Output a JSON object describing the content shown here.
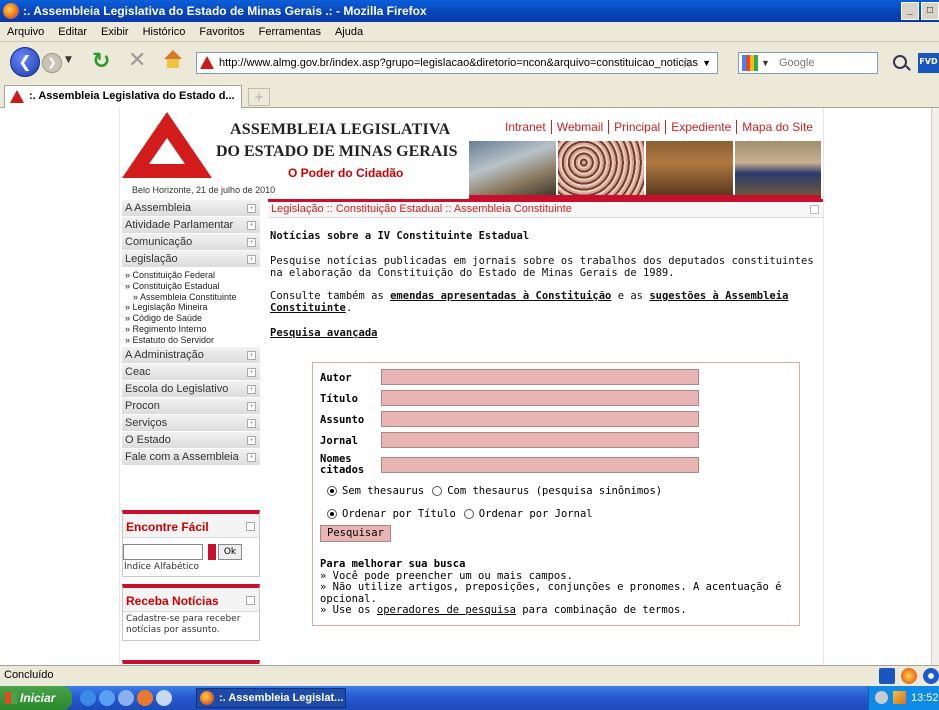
{
  "window": {
    "title": ":. Assembleia Legislativa do Estado de Minas Gerais .: - Mozilla Firefox",
    "controls": [
      "_",
      "□"
    ]
  },
  "menu": [
    "Arquivo",
    "Editar",
    "Exibir",
    "Histórico",
    "Favoritos",
    "Ferramentas",
    "Ajuda"
  ],
  "nav": {
    "url": "http://www.almg.gov.br/index.asp?grupo=legislacao&diretorio=ncon&arquivo=constituicao_noticias",
    "search_placeholder": "Google"
  },
  "tab": {
    "title": ":. Assembleia Legislativa do Estado d..."
  },
  "site": {
    "brand_line1": "ASSEMBLEIA LEGISLATIVA",
    "brand_line2": "DO ESTADO DE MINAS GERAIS",
    "slogan": "O Poder do Cidadão",
    "date": "Belo Horizonte, 21 de julho de 2010",
    "toplinks": [
      "Intranet",
      "Webmail",
      "Principal",
      "Expediente",
      "Mapa do Site"
    ],
    "brand_color": "#c8102e"
  },
  "sidebar": {
    "cats_top": [
      "A Assembleia",
      "Atividade Parlamentar",
      "Comunicação",
      "Legislação"
    ],
    "legislacao_sub": [
      "» Constituição Federal",
      "» Constituição Estadual",
      "» Assembleia Constituinte",
      "» Legislação Mineira",
      "» Código de Saúde",
      "» Regimento Interno",
      "» Estatuto do Servidor"
    ],
    "cats_bottom": [
      "A Administração",
      "Ceac",
      "Escola do Legislativo",
      "Procon",
      "Serviços",
      "O Estado",
      "Fale com a Assembleia"
    ]
  },
  "encontre": {
    "title": "Encontre Fácil",
    "button": "Ok",
    "index_link": "Índice Alfabético"
  },
  "noticias": {
    "title": "Receba Notícias",
    "text": "Cadastre-se para receber notícias por assunto."
  },
  "main": {
    "breadcrumb": "Legislação :: Constituição Estadual :: Assembleia Constituinte",
    "heading": "Notícias sobre a IV Constituinte Estadual",
    "intro": "Pesquise notícias publicadas em jornais sobre os trabalhos dos deputados constituintes na elaboração da Constituição do Estado de Minas Gerais de 1989.",
    "consult_pre": "Consulte também as ",
    "link_emendas": "emendas apresentadas à Constituição",
    "consult_mid": " e as ",
    "link_sugestoes": "sugestões à Assembleia Constituinte",
    "consult_end": ".",
    "advanced": "Pesquisa avançada"
  },
  "form": {
    "fields": [
      "Autor",
      "Título",
      "Assunto",
      "Jornal",
      "Nomes citados"
    ],
    "radio_thesaurus": [
      "Sem thesaurus",
      "Com thesaurus (pesquisa sinônimos)"
    ],
    "radio_order": [
      "Ordenar por Título",
      "Ordenar por Jornal"
    ],
    "submit": "Pesquisar"
  },
  "tips": {
    "title": "Para melhorar sua busca",
    "line1": "» Você pode preencher um ou mais campos.",
    "line2": "» Não utilize artigos, preposições, conjunções e pronomes. A acentuação é opcional.",
    "line3_pre": "» Use os ",
    "line3_link": "operadores de pesquisa",
    "line3_post": " para combinação de termos."
  },
  "status": {
    "text": "Concluído"
  },
  "taskbar": {
    "start": "Iniciar",
    "task": ":. Assembleia Legislat...",
    "clock": "13:52"
  }
}
